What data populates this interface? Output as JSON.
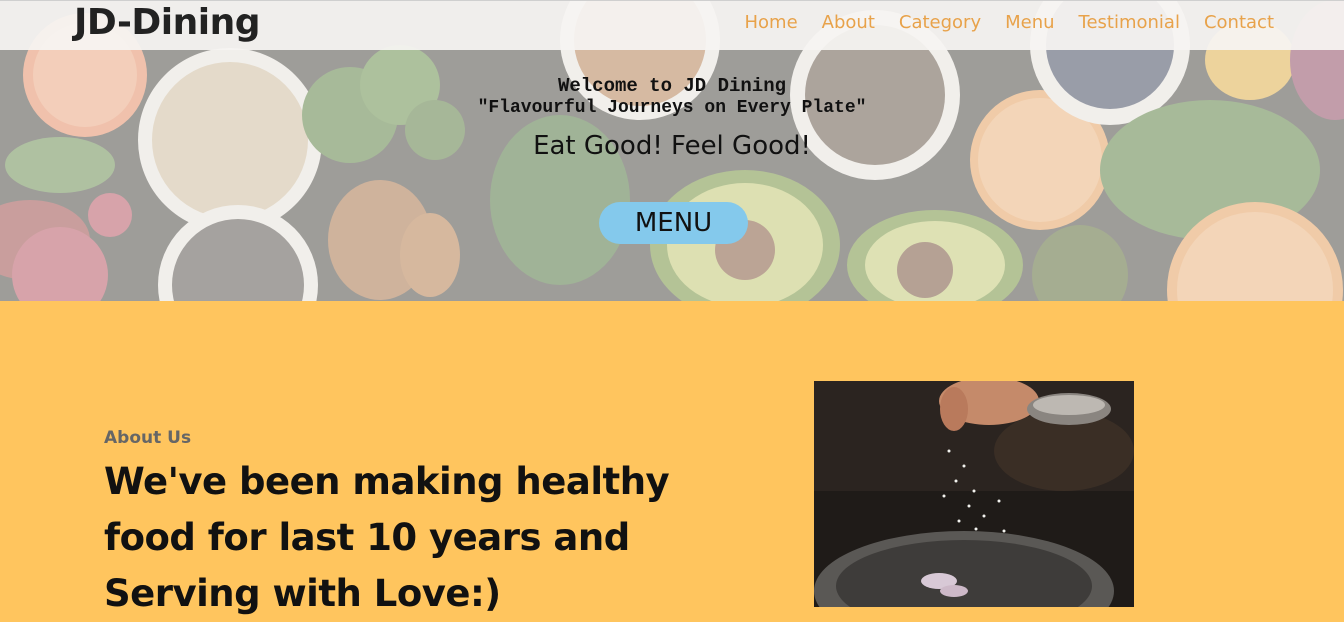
{
  "brand": "JD-Dining",
  "nav": {
    "home": "Home",
    "about": "About",
    "category": "Category",
    "menu": "Menu",
    "testimonial": "Testimonial",
    "contact": "Contact"
  },
  "hero": {
    "welcome": "Welcome to JD Dining",
    "tagline": "\"Flavourful Journeys on Every Plate\"",
    "slogan": "Eat Good! Feel Good!",
    "menu_button": "MENU"
  },
  "about": {
    "label": "About Us",
    "heading": "We've been making healthy food for last 10 years and Serving with Love:)"
  },
  "colors": {
    "nav_link": "#e8a24a",
    "section_bg": "#ffc55e",
    "menu_button_bg": "#84c9ec"
  }
}
